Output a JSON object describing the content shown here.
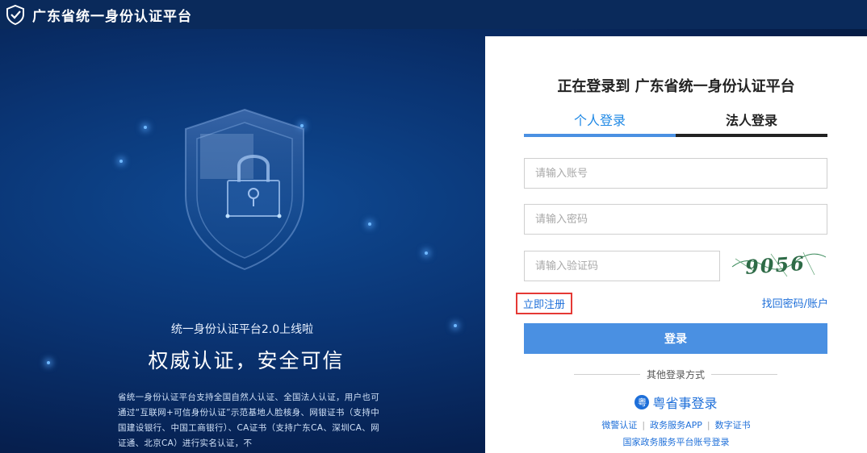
{
  "header": {
    "title": "广东省统一身份认证平台"
  },
  "hero": {
    "subtitle": "统一身份认证平台2.0上线啦",
    "slogan": "权威认证，安全可信",
    "description": "省统一身份认证平台支持全国自然人认证、全国法人认证，用户也可通过“互联网+可信身份认证”示范基地人脸核身、网银证书（支持中国建设银行、中国工商银行）、CA证书（支持广东CA、深圳CA、网证通、北京CA）进行实名认证，不"
  },
  "login": {
    "title": "正在登录到 广东省统一身份认证平台",
    "tabs": [
      "个人登录",
      "法人登录"
    ],
    "account_placeholder": "请输入账号",
    "password_placeholder": "请输入密码",
    "captcha_placeholder": "请输入验证码",
    "captcha_text": "9056",
    "register": "立即注册",
    "forgot": "找回密码/账户",
    "submit": "登录",
    "other_methods": "其他登录方式",
    "yss_icon": "粤",
    "yss_login": "粤省事登录",
    "links": [
      "微警认证",
      "政务服务APP",
      "数字证书"
    ],
    "national_link": "国家政务服务平台账号登录"
  },
  "colors": {
    "accent": "#4a90e2",
    "link": "#1e6fd9",
    "highlight": "#e53935",
    "header_bg": "#0a2a5b"
  }
}
